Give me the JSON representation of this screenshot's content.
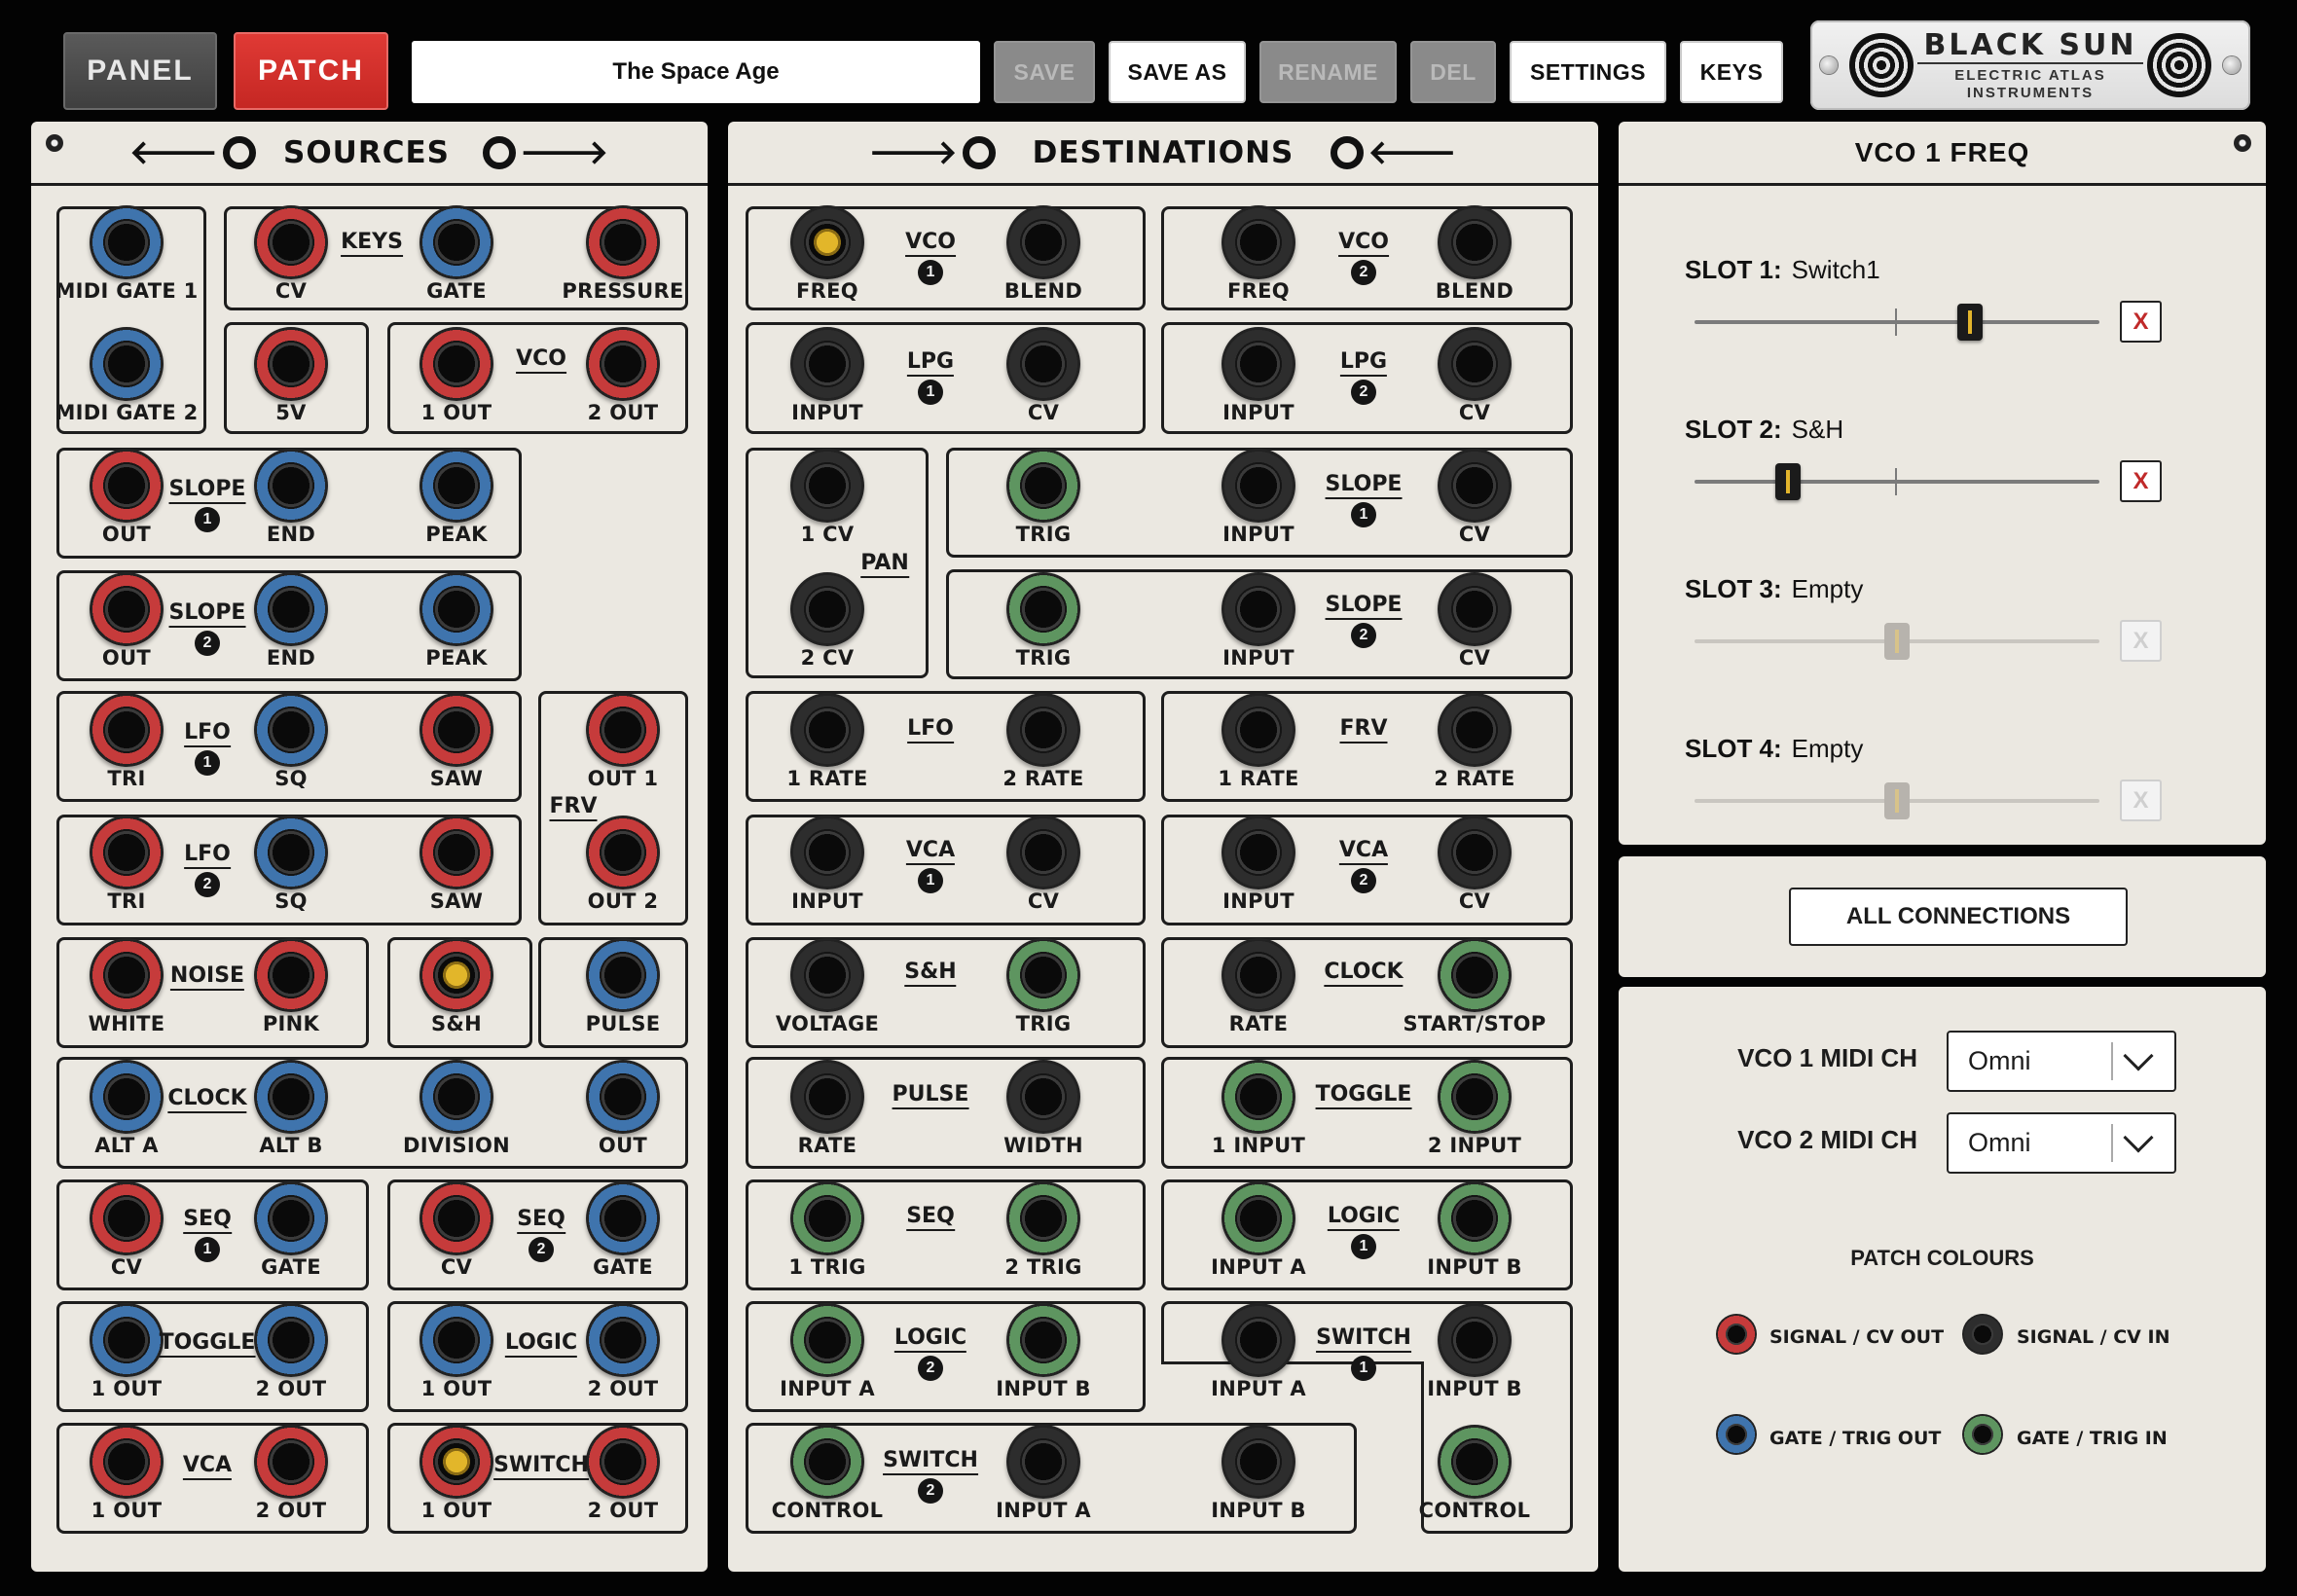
{
  "topbar": {
    "panel": "PANEL",
    "patch": "PATCH",
    "patch_name": "The Space Age",
    "save": "SAVE",
    "save_as": "SAVE AS",
    "rename": "RENAME",
    "del": "DEL",
    "settings": "SETTINGS",
    "keys": "KEYS"
  },
  "logo": {
    "brand": "BLACK SUN",
    "line1": "ELECTRIC ATLAS",
    "line2": "INSTRUMENTS"
  },
  "sources": {
    "title": "SOURCES",
    "modules": {
      "midi_gate_1": "MIDI GATE 1",
      "midi_gate_2": "MIDI GATE 2",
      "keys": "KEYS",
      "keys_cv": "CV",
      "keys_gate": "GATE",
      "keys_pressure": "PRESSURE",
      "keys_5v": "5V",
      "vco": "VCO",
      "vco_1_out": "1 OUT",
      "vco_2_out": "2 OUT",
      "slope": "SLOPE",
      "slope1_num": "1",
      "slope2_num": "2",
      "out": "OUT",
      "end": "END",
      "peak": "PEAK",
      "lfo": "LFO",
      "lfo1_num": "1",
      "lfo2_num": "2",
      "tri": "TRI",
      "sq": "SQ",
      "saw": "SAW",
      "frv": "FRV",
      "frv_out1": "OUT 1",
      "frv_out2": "OUT 2",
      "noise": "NOISE",
      "white": "WHITE",
      "pink": "PINK",
      "sh": "S&H",
      "pulse": "PULSE",
      "clock": "CLOCK",
      "alt_a": "ALT A",
      "alt_b": "ALT B",
      "division": "DIVISION",
      "seq": "SEQ",
      "seq1_num": "1",
      "seq2_num": "2",
      "cv": "CV",
      "gate": "GATE",
      "toggle": "TOGGLE",
      "one_out": "1 OUT",
      "two_out": "2 OUT",
      "logic": "LOGIC",
      "vca": "VCA",
      "switch": "SWITCH"
    }
  },
  "destinations": {
    "title": "DESTINATIONS",
    "modules": {
      "vco": "VCO",
      "vco1_num": "1",
      "vco2_num": "2",
      "freq": "FREQ",
      "blend": "BLEND",
      "lpg": "LPG",
      "lpg1_num": "1",
      "lpg2_num": "2",
      "input": "INPUT",
      "cv": "CV",
      "pan": "PAN",
      "pan_1cv": "1 CV",
      "pan_2cv": "2 CV",
      "slope": "SLOPE",
      "slope1_num": "1",
      "slope2_num": "2",
      "trig": "TRIG",
      "lfo": "LFO",
      "frv": "FRV",
      "rate1": "1 RATE",
      "rate2": "2 RATE",
      "vca": "VCA",
      "vca1_num": "1",
      "vca2_num": "2",
      "sh": "S&H",
      "voltage": "VOLTAGE",
      "clock": "CLOCK",
      "rate": "RATE",
      "start_stop": "START/STOP",
      "pulse": "PULSE",
      "width": "WIDTH",
      "toggle": "TOGGLE",
      "input1": "1 INPUT",
      "input2": "2 INPUT",
      "seq": "SEQ",
      "trig1": "1 TRIG",
      "trig2": "2 TRIG",
      "logic": "LOGIC",
      "logic1_num": "1",
      "logic2_num": "2",
      "input_a": "INPUT A",
      "input_b": "INPUT B",
      "switch": "SWITCH",
      "switch1_num": "1",
      "switch2_num": "2",
      "control": "CONTROL"
    }
  },
  "inspector": {
    "title": "VCO 1 FREQ",
    "slots": [
      {
        "label": "SLOT 1:",
        "value": "Switch1",
        "level": 0.68,
        "active": true,
        "x": "X"
      },
      {
        "label": "SLOT 2:",
        "value": "S&H",
        "level": 0.23,
        "active": true,
        "x": "X"
      },
      {
        "label": "SLOT 3:",
        "value": "Empty",
        "level": 0.5,
        "active": false,
        "x": "X"
      },
      {
        "label": "SLOT 4:",
        "value": "Empty",
        "level": 0.5,
        "active": false,
        "x": "X"
      }
    ],
    "all_connections": "ALL CONNECTIONS",
    "midi": [
      {
        "label": "VCO 1 MIDI CH",
        "value": "Omni"
      },
      {
        "label": "VCO 2 MIDI CH",
        "value": "Omni"
      }
    ],
    "patch_colours": {
      "title": "PATCH COLOURS",
      "items": [
        {
          "label": "SIGNAL / CV OUT",
          "color": "#c63b3b"
        },
        {
          "label": "SIGNAL / CV IN",
          "color": "#2d2d2d"
        },
        {
          "label": "GATE / TRIG OUT",
          "color": "#3f74ad"
        },
        {
          "label": "GATE / TRIG IN",
          "color": "#5e9560"
        }
      ]
    }
  },
  "colors": {
    "signal_out": "#c63b3b",
    "signal_in": "#2d2d2d",
    "gate_out": "#3f74ad",
    "gate_in": "#5e9560",
    "patch_accent": "#d0302c",
    "selected_jack": "#e2b62a"
  }
}
